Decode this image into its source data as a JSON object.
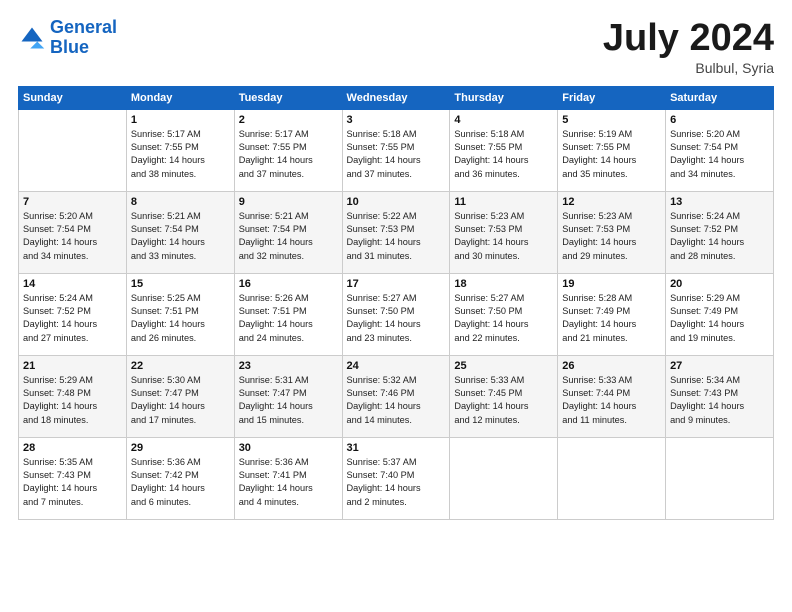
{
  "header": {
    "logo_line1": "General",
    "logo_line2": "Blue",
    "month_year": "July 2024",
    "location": "Bulbul, Syria"
  },
  "days_of_week": [
    "Sunday",
    "Monday",
    "Tuesday",
    "Wednesday",
    "Thursday",
    "Friday",
    "Saturday"
  ],
  "weeks": [
    [
      {
        "day": "",
        "info": ""
      },
      {
        "day": "1",
        "info": "Sunrise: 5:17 AM\nSunset: 7:55 PM\nDaylight: 14 hours\nand 38 minutes."
      },
      {
        "day": "2",
        "info": "Sunrise: 5:17 AM\nSunset: 7:55 PM\nDaylight: 14 hours\nand 37 minutes."
      },
      {
        "day": "3",
        "info": "Sunrise: 5:18 AM\nSunset: 7:55 PM\nDaylight: 14 hours\nand 37 minutes."
      },
      {
        "day": "4",
        "info": "Sunrise: 5:18 AM\nSunset: 7:55 PM\nDaylight: 14 hours\nand 36 minutes."
      },
      {
        "day": "5",
        "info": "Sunrise: 5:19 AM\nSunset: 7:55 PM\nDaylight: 14 hours\nand 35 minutes."
      },
      {
        "day": "6",
        "info": "Sunrise: 5:20 AM\nSunset: 7:54 PM\nDaylight: 14 hours\nand 34 minutes."
      }
    ],
    [
      {
        "day": "7",
        "info": "Sunrise: 5:20 AM\nSunset: 7:54 PM\nDaylight: 14 hours\nand 34 minutes."
      },
      {
        "day": "8",
        "info": "Sunrise: 5:21 AM\nSunset: 7:54 PM\nDaylight: 14 hours\nand 33 minutes."
      },
      {
        "day": "9",
        "info": "Sunrise: 5:21 AM\nSunset: 7:54 PM\nDaylight: 14 hours\nand 32 minutes."
      },
      {
        "day": "10",
        "info": "Sunrise: 5:22 AM\nSunset: 7:53 PM\nDaylight: 14 hours\nand 31 minutes."
      },
      {
        "day": "11",
        "info": "Sunrise: 5:23 AM\nSunset: 7:53 PM\nDaylight: 14 hours\nand 30 minutes."
      },
      {
        "day": "12",
        "info": "Sunrise: 5:23 AM\nSunset: 7:53 PM\nDaylight: 14 hours\nand 29 minutes."
      },
      {
        "day": "13",
        "info": "Sunrise: 5:24 AM\nSunset: 7:52 PM\nDaylight: 14 hours\nand 28 minutes."
      }
    ],
    [
      {
        "day": "14",
        "info": "Sunrise: 5:24 AM\nSunset: 7:52 PM\nDaylight: 14 hours\nand 27 minutes."
      },
      {
        "day": "15",
        "info": "Sunrise: 5:25 AM\nSunset: 7:51 PM\nDaylight: 14 hours\nand 26 minutes."
      },
      {
        "day": "16",
        "info": "Sunrise: 5:26 AM\nSunset: 7:51 PM\nDaylight: 14 hours\nand 24 minutes."
      },
      {
        "day": "17",
        "info": "Sunrise: 5:27 AM\nSunset: 7:50 PM\nDaylight: 14 hours\nand 23 minutes."
      },
      {
        "day": "18",
        "info": "Sunrise: 5:27 AM\nSunset: 7:50 PM\nDaylight: 14 hours\nand 22 minutes."
      },
      {
        "day": "19",
        "info": "Sunrise: 5:28 AM\nSunset: 7:49 PM\nDaylight: 14 hours\nand 21 minutes."
      },
      {
        "day": "20",
        "info": "Sunrise: 5:29 AM\nSunset: 7:49 PM\nDaylight: 14 hours\nand 19 minutes."
      }
    ],
    [
      {
        "day": "21",
        "info": "Sunrise: 5:29 AM\nSunset: 7:48 PM\nDaylight: 14 hours\nand 18 minutes."
      },
      {
        "day": "22",
        "info": "Sunrise: 5:30 AM\nSunset: 7:47 PM\nDaylight: 14 hours\nand 17 minutes."
      },
      {
        "day": "23",
        "info": "Sunrise: 5:31 AM\nSunset: 7:47 PM\nDaylight: 14 hours\nand 15 minutes."
      },
      {
        "day": "24",
        "info": "Sunrise: 5:32 AM\nSunset: 7:46 PM\nDaylight: 14 hours\nand 14 minutes."
      },
      {
        "day": "25",
        "info": "Sunrise: 5:33 AM\nSunset: 7:45 PM\nDaylight: 14 hours\nand 12 minutes."
      },
      {
        "day": "26",
        "info": "Sunrise: 5:33 AM\nSunset: 7:44 PM\nDaylight: 14 hours\nand 11 minutes."
      },
      {
        "day": "27",
        "info": "Sunrise: 5:34 AM\nSunset: 7:43 PM\nDaylight: 14 hours\nand 9 minutes."
      }
    ],
    [
      {
        "day": "28",
        "info": "Sunrise: 5:35 AM\nSunset: 7:43 PM\nDaylight: 14 hours\nand 7 minutes."
      },
      {
        "day": "29",
        "info": "Sunrise: 5:36 AM\nSunset: 7:42 PM\nDaylight: 14 hours\nand 6 minutes."
      },
      {
        "day": "30",
        "info": "Sunrise: 5:36 AM\nSunset: 7:41 PM\nDaylight: 14 hours\nand 4 minutes."
      },
      {
        "day": "31",
        "info": "Sunrise: 5:37 AM\nSunset: 7:40 PM\nDaylight: 14 hours\nand 2 minutes."
      },
      {
        "day": "",
        "info": ""
      },
      {
        "day": "",
        "info": ""
      },
      {
        "day": "",
        "info": ""
      }
    ]
  ]
}
